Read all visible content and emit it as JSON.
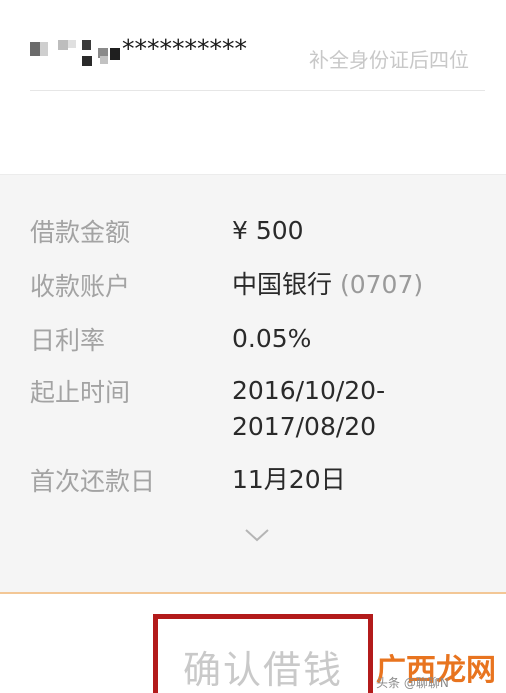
{
  "id_field": {
    "masked_value": "**********",
    "hint": "补全身份证后四位"
  },
  "loan_details": [
    {
      "label": "借款金额",
      "value": "¥ 500",
      "value_suffix": ""
    },
    {
      "label": "收款账户",
      "value": "中国银行",
      "value_suffix": "(0707)"
    },
    {
      "label": "日利率",
      "value": "0.05%",
      "value_suffix": ""
    },
    {
      "label": "起止时间",
      "value": "2016/10/20-",
      "value_line2": "2017/08/20",
      "value_suffix": ""
    },
    {
      "label": "首次还款日",
      "value": "11月20日",
      "value_suffix": ""
    }
  ],
  "expand_icon": "chevron-down-icon",
  "confirm_button": {
    "label": "确认借钱",
    "state": "disabled",
    "highlight_color": "#b31b1b"
  },
  "watermark": {
    "brand": "广西龙网",
    "source": "头条 @聊聊N"
  },
  "colors": {
    "panel_bg": "#f5f5f5",
    "accent_rule": "#f3c796",
    "label_text": "#a3a3a3",
    "value_text": "#2a2a2a"
  }
}
